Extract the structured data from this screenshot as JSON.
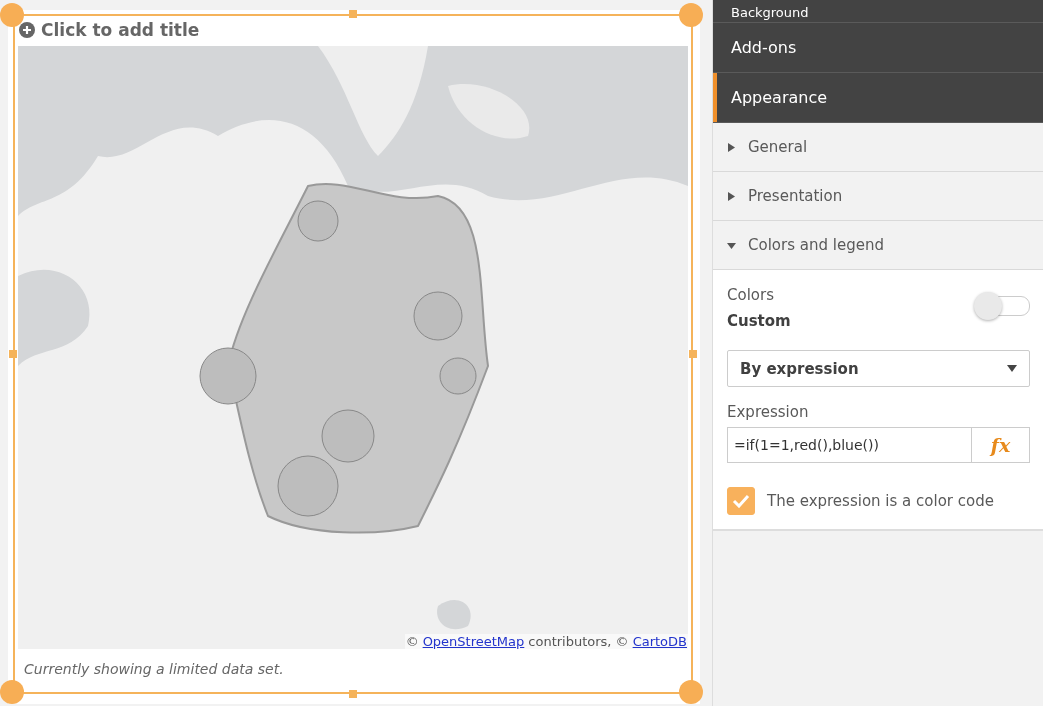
{
  "chart_card": {
    "title": "Click to add title",
    "selected": true,
    "attribution": {
      "prefix": "©",
      "link_1": "OpenStreetMap",
      "middle": "contributors, ©",
      "link_2": "CartoDB"
    },
    "footnote": "Currently showing a limited data set."
  },
  "panel": {
    "sections": [
      {
        "label": "Background",
        "kind": "tab",
        "selected": false
      },
      {
        "label": "Add-ons",
        "kind": "tab",
        "selected": false
      },
      {
        "label": "Appearance",
        "kind": "tab",
        "selected": true
      },
      {
        "label": "General",
        "kind": "group",
        "expanded": false
      },
      {
        "label": "Presentation",
        "kind": "group",
        "expanded": false
      },
      {
        "label": "Colors and legend",
        "kind": "group",
        "expanded": true
      }
    ],
    "colors": {
      "label": "Colors",
      "mode": "Custom",
      "toggle_on": false,
      "dropdown": "By expression",
      "expression_label": "Expression",
      "expression": "=if(1=1,red(),blue())",
      "fx": "fx",
      "checkbox": {
        "label": "The expression is a color code",
        "checked": true
      }
    }
  }
}
